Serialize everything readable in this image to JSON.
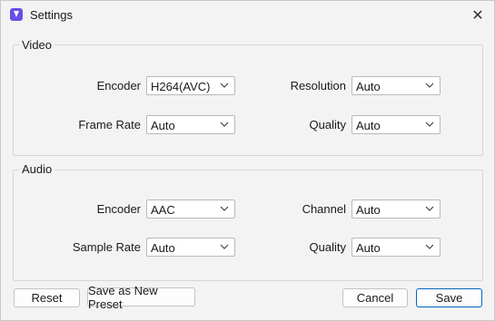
{
  "window": {
    "title": "Settings",
    "close_symbol": "✕",
    "app_icon": "app-icon",
    "accent": "#6b4de6"
  },
  "video": {
    "title": "Video",
    "encoder_label": "Encoder",
    "encoder_value": "H264(AVC)",
    "resolution_label": "Resolution",
    "resolution_value": "Auto",
    "frame_rate_label": "Frame Rate",
    "frame_rate_value": "Auto",
    "quality_label": "Quality",
    "quality_value": "Auto"
  },
  "audio": {
    "title": "Audio",
    "encoder_label": "Encoder",
    "encoder_value": "AAC",
    "channel_label": "Channel",
    "channel_value": "Auto",
    "sample_rate_label": "Sample Rate",
    "sample_rate_value": "Auto",
    "quality_label": "Quality",
    "quality_value": "Auto"
  },
  "buttons": {
    "reset": "Reset",
    "save_preset": "Save as New Preset",
    "cancel": "Cancel",
    "save": "Save"
  }
}
